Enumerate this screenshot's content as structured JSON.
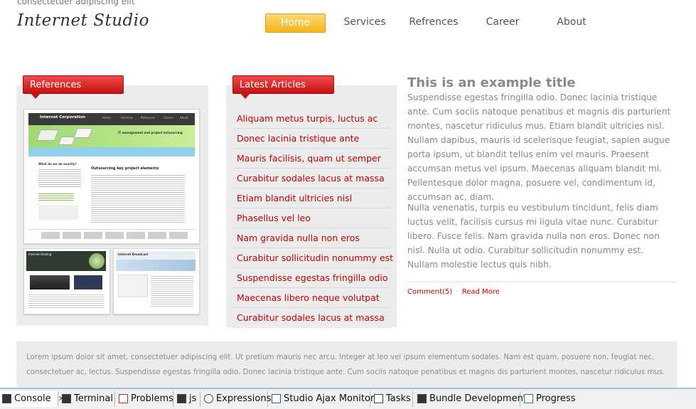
{
  "header": {
    "tagline": "consectetuer adipiscing elit",
    "logo": "Internet Studio",
    "nav": [
      "Home",
      "Services",
      "Refrences",
      "Career",
      "About"
    ]
  },
  "references": {
    "tab": "References",
    "thumb_main": {
      "brand": "Internet Corporation",
      "menu": [
        "Home",
        "Services",
        "Refrences",
        "Career",
        "About"
      ],
      "banner": "IT management and project outsourcing",
      "heading": "Outsourcing key project elements",
      "side_title": "What do we do exactly?"
    },
    "thumb_small_1": {
      "brand": "Internet Hosting"
    },
    "thumb_small_2": {
      "brand": "Internet Broadcast"
    }
  },
  "articles": {
    "tab": "Latest Articles",
    "items": [
      "Aliquam metus turpis, luctus ac",
      "Donec lacinia tristique ante",
      "Mauris facilisis, quam ut semper",
      "Curabitur sodales lacus at massa",
      "Etiam blandit ultricies nisl",
      "Phasellus vel leo",
      "Nam gravida nulla non eros",
      "Curabitur sollicitudin nonummy est",
      "Suspendisse egestas fringilla odio",
      "Maecenas libero neque volutpat",
      "Curabitur sodales lacus at massa"
    ]
  },
  "post": {
    "title": "This is an example title",
    "p1": "Suspendisse egestas fringilla odio. Donec lacinia tristique ante. Cum sociis natoque penatibus et magnis dis parturient montes, nascetur ridiculus mus. Etiam blandit ultricies nisl. Nullam dapibus, mauris id scelerisque feugiat, sapien augue porta ipsum, ut blandit tellus enim vel mauris. Praesent accumsan metus vel ipsum. Maecenas aliquam blandit mi. Pellentesque dolor magna, posuere vel, condimentum id, accumsan ac, diam.",
    "p2": "Nulla venenatis, turpis eu vestibulum tincidunt, felis diam luctus velit, facilisis cursus mi ligula vitae nunc. Curabitur libero. Fusce felis. Nam gravida nulla non eros. Donec non nisl. Nulla ut odio. Curabitur sollicitudin nonummy est. Nullam molestie lectus quis nibh.",
    "comments": "Comment(5)",
    "sep": "·",
    "read_more": "Read More"
  },
  "footer": {
    "text": "Lorem ipsum dolor sit amet, consectetuer adipiscing elit. Ut pretium mauris nec arcu. Integer at leo vel ipsum elementum sodales. Nam est quam, posuere non, feugiat nec, consectetuer ac, lectus. Suspendisse egestas fringilla odio. Donec lacinia tristique ante. Cum sociis natoque penatibus et magnis dis parturient montes, nascetur ridiculus mus."
  },
  "ide": {
    "tabs": [
      "Console",
      "Terminal",
      "Problems",
      "js",
      "Expressions",
      "Studio Ajax Monitor",
      "Tasks",
      "Bundle Development",
      "Progress"
    ],
    "close_glyph": "✕"
  }
}
